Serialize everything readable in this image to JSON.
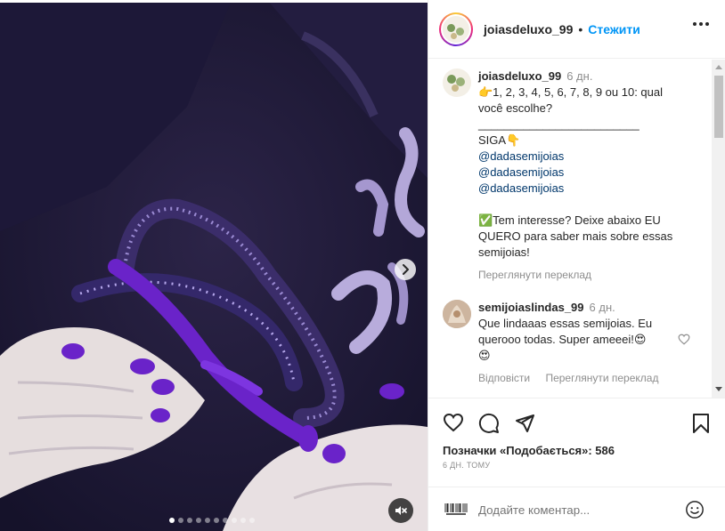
{
  "post": {
    "username": "joiasdeluxo_99",
    "follow_label": "Стежити",
    "dot": "•"
  },
  "caption": {
    "username": "joiasdeluxo_99",
    "time": "6 дн.",
    "lines": [
      "👉1, 2, 3, 4, 5, 6, 7, 8, 9 ou 10: qual",
      "você escolhe?",
      "_________________________",
      "SIGA👇",
      "@dadasemijoias",
      "@dadasemijoias",
      "@dadasemijoias",
      "✅Tem interesse? Deixe abaixo EU",
      "QUERO para saber mais sobre essas",
      "semijoias!"
    ],
    "see_translation": "Переглянути переклад"
  },
  "comment": {
    "username": "semijoiaslindas_99",
    "time": "6 дн.",
    "lines": [
      "Que lindaaas essas semijoias. Eu",
      "querooo todas. Super ameeei!😍",
      "😍"
    ],
    "reply_label": "Відповісти",
    "see_translation": "Переглянути переклад"
  },
  "likes_text": "Позначки «Подобається»: 586",
  "date_text": "6 ДН. ТОМУ",
  "add_comment": {
    "placeholder": "Додайте коментар...",
    "emoji_icon": "smiley-icon"
  },
  "carousel": {
    "slides": 10,
    "active_index": 0
  },
  "colors": {
    "link": "#0095f6",
    "mention": "#00376b",
    "muted": "#8e8e8e",
    "nail": "#6a23c9"
  }
}
